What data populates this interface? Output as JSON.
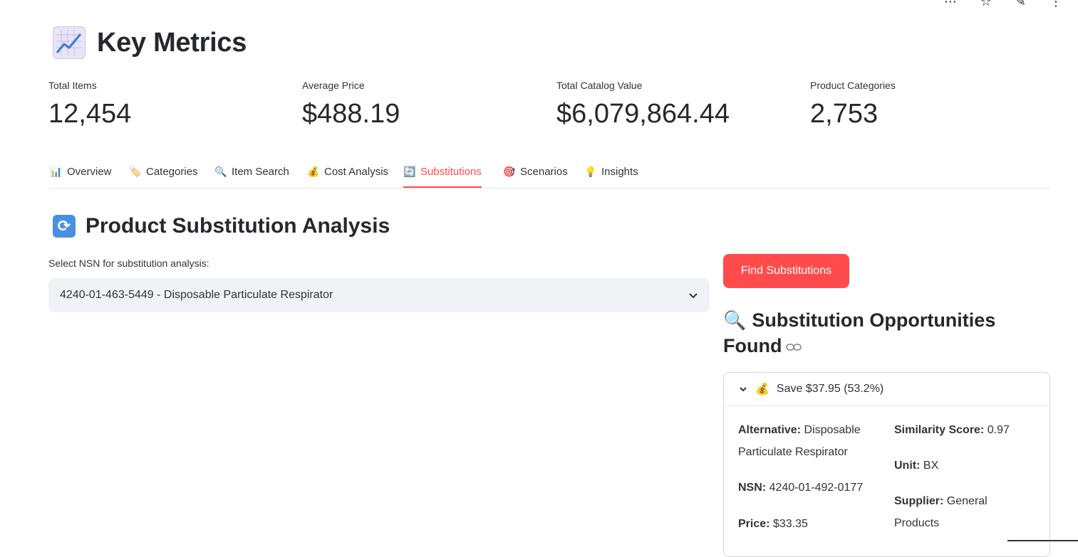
{
  "header": {
    "title": "Key Metrics",
    "icon": "chart-increasing-icon"
  },
  "metrics": [
    {
      "label": "Total Items",
      "value": "12,454"
    },
    {
      "label": "Average Price",
      "value": "$488.19"
    },
    {
      "label": "Total Catalog Value",
      "value": "$6,079,864.44"
    },
    {
      "label": "Product Categories",
      "value": "2,753"
    }
  ],
  "tabs": [
    {
      "label": "Overview",
      "icon": "📊"
    },
    {
      "label": "Categories",
      "icon": "🏷️"
    },
    {
      "label": "Item Search",
      "icon": "🔍"
    },
    {
      "label": "Cost Analysis",
      "icon": "💰"
    },
    {
      "label": "Substitutions",
      "icon": "🔄",
      "active": true
    },
    {
      "label": "Scenarios",
      "icon": "🎯"
    },
    {
      "label": "Insights",
      "icon": "💡"
    }
  ],
  "section": {
    "title": "Product Substitution Analysis",
    "icon": "🔄"
  },
  "select": {
    "label": "Select NSN for substitution analysis:",
    "value": "4240-01-463-5449 - Disposable Particulate Respirator"
  },
  "action": {
    "button_label": "Find Substitutions"
  },
  "opportunities": {
    "title": "Substitution Opportunities Found",
    "icon": "🔍",
    "expander": {
      "icon": "💰",
      "header": "Save $37.95 (53.2%)",
      "fields": {
        "alternative_label": "Alternative:",
        "alternative_value": "Disposable Particulate Respirator",
        "nsn_label": "NSN:",
        "nsn_value": "4240-01-492-0177",
        "price_label": "Price:",
        "price_value": "$33.35",
        "similarity_label": "Similarity Score:",
        "similarity_value": "0.97",
        "unit_label": "Unit:",
        "unit_value": "BX",
        "supplier_label": "Supplier:",
        "supplier_value": "General Products"
      }
    }
  },
  "colors": {
    "accent": "#ff4b4b",
    "text": "#31333f",
    "input_bg": "#f0f2f6"
  }
}
